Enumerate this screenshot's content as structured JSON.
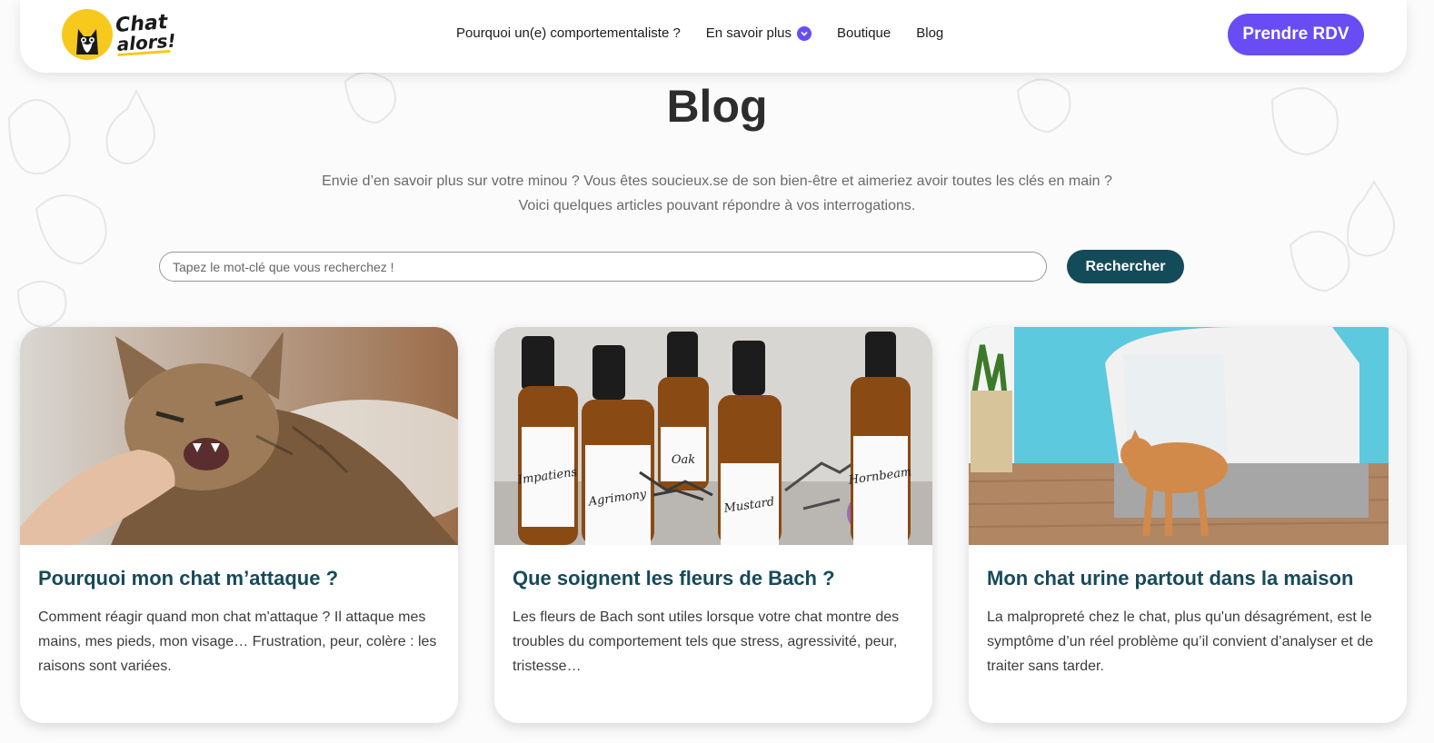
{
  "header": {
    "logo_line1": "Chat",
    "logo_line2": "alors!",
    "nav": [
      {
        "label": "Pourquoi un(e) comportementaliste ?"
      },
      {
        "label": "En savoir plus"
      },
      {
        "label": "Boutique"
      },
      {
        "label": "Blog"
      }
    ],
    "cta_label": "Prendre RDV"
  },
  "page": {
    "title": "Blog",
    "intro_line1": "Envie d’en savoir plus sur votre minou ? Vous êtes soucieux.se de son bien-être et aimeriez avoir toutes les clés en main ?",
    "intro_line2": "Voici quelques articles pouvant répondre à vos interrogations."
  },
  "search": {
    "placeholder": "Tapez le mot-clé que vous recherchez !",
    "button_label": "Rechercher"
  },
  "articles": [
    {
      "title": "Pourquoi mon chat m’attaque ?",
      "excerpt": "Comment réagir quand mon chat m'attaque ? Il attaque mes mains, mes pieds, mon visage… Frustration, peur, colère : les raisons sont variées."
    },
    {
      "title": "Que soignent les fleurs de Bach ?",
      "excerpt": "Les fleurs de Bach sont utiles lorsque votre chat montre des troubles du comportement tels que stress, agressivité, peur, tristesse…",
      "bottle_labels": [
        "Impatiens",
        "Agrimony",
        "Oak",
        "Mustard",
        "Hornbeam"
      ]
    },
    {
      "title": "Mon chat urine partout dans la maison",
      "excerpt": "La malpropreté chez le chat, plus qu'un désagrément, est le symptôme d’un réel problème qu’il convient d’analyser et de traiter sans tarder."
    }
  ],
  "colors": {
    "accent_purple": "#6a4cf5",
    "search_button": "#144b58",
    "card_title": "#164a5a",
    "logo_yellow": "#f7c91d"
  }
}
